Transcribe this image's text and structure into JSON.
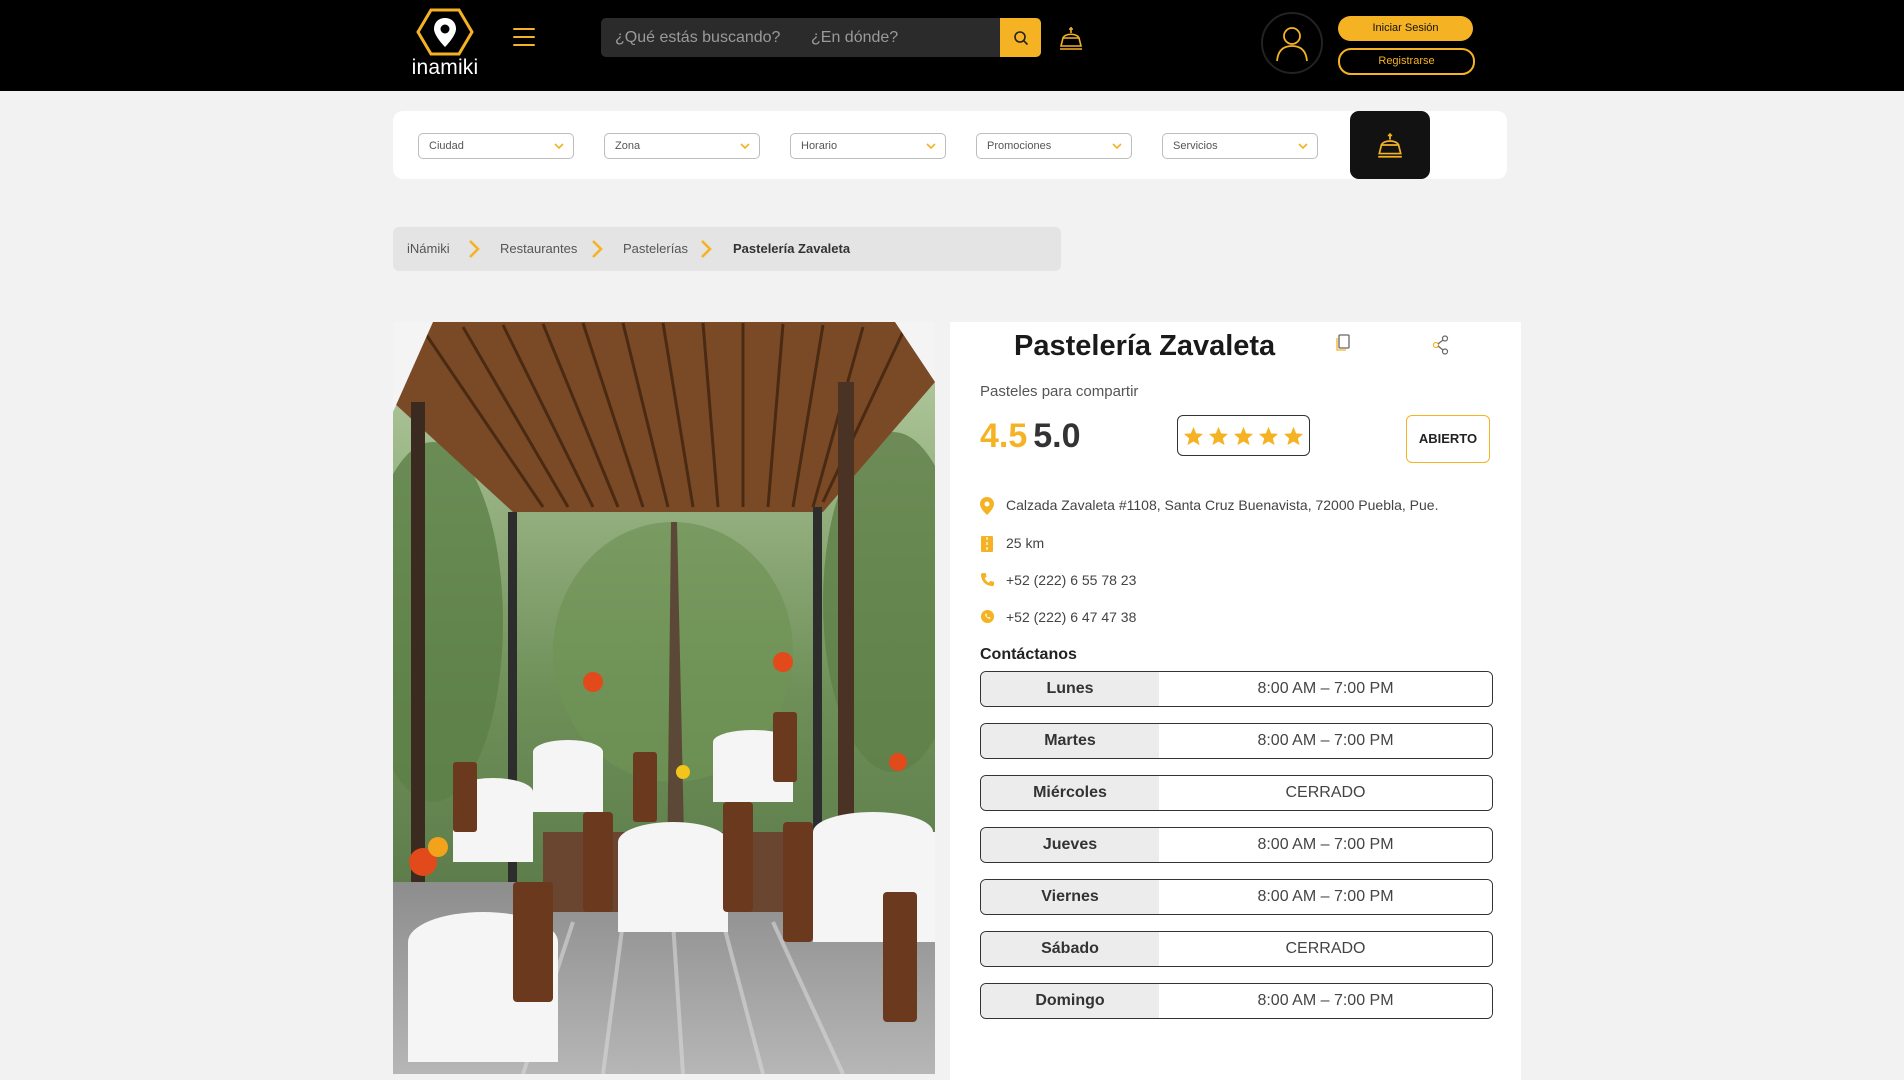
{
  "header": {
    "logo_text": "inamiki",
    "search_what_placeholder": "¿Qué estás buscando?",
    "search_where_placeholder": "¿En dónde?",
    "login_label": "Iniciar Sesión",
    "register_label": "Registrarse"
  },
  "filters": [
    {
      "label": "Ciudad"
    },
    {
      "label": "Zona"
    },
    {
      "label": "Horario"
    },
    {
      "label": "Promociones"
    },
    {
      "label": "Servicios"
    }
  ],
  "breadcrumb": [
    {
      "label": "iNámiki"
    },
    {
      "label": "Restaurantes"
    },
    {
      "label": "Pastelerías"
    },
    {
      "label": "Pastelería Zavaleta"
    }
  ],
  "business": {
    "name": "Pastelería Zavaleta",
    "tagline": "Pasteles para compartir",
    "rating": "4.5",
    "rating_max": "5.0",
    "stars": 5,
    "status": "ABIERTO",
    "address": "Calzada Zavaleta #1108, Santa Cruz Buenavista, 72000 Puebla, Pue.",
    "distance": "25 km",
    "phone": "+52 (222) 6 55 78 23",
    "whatsapp": "+52 (222) 6 47 47 38"
  },
  "hours_title": "Contáctanos",
  "hours": [
    {
      "day": "Lunes",
      "time": "8:00 AM – 7:00 PM"
    },
    {
      "day": "Martes",
      "time": "8:00 AM – 7:00 PM"
    },
    {
      "day": "Miércoles",
      "time": "CERRADO"
    },
    {
      "day": "Jueves",
      "time": "8:00 AM – 7:00 PM"
    },
    {
      "day": "Viernes",
      "time": "8:00 AM – 7:00 PM"
    },
    {
      "day": "Sábado",
      "time": "CERRADO"
    },
    {
      "day": "Domingo",
      "time": "8:00 AM – 7:00 PM"
    }
  ],
  "colors": {
    "accent": "#f5b324",
    "header_bg": "#000000",
    "page_bg": "#f2f2f2"
  }
}
